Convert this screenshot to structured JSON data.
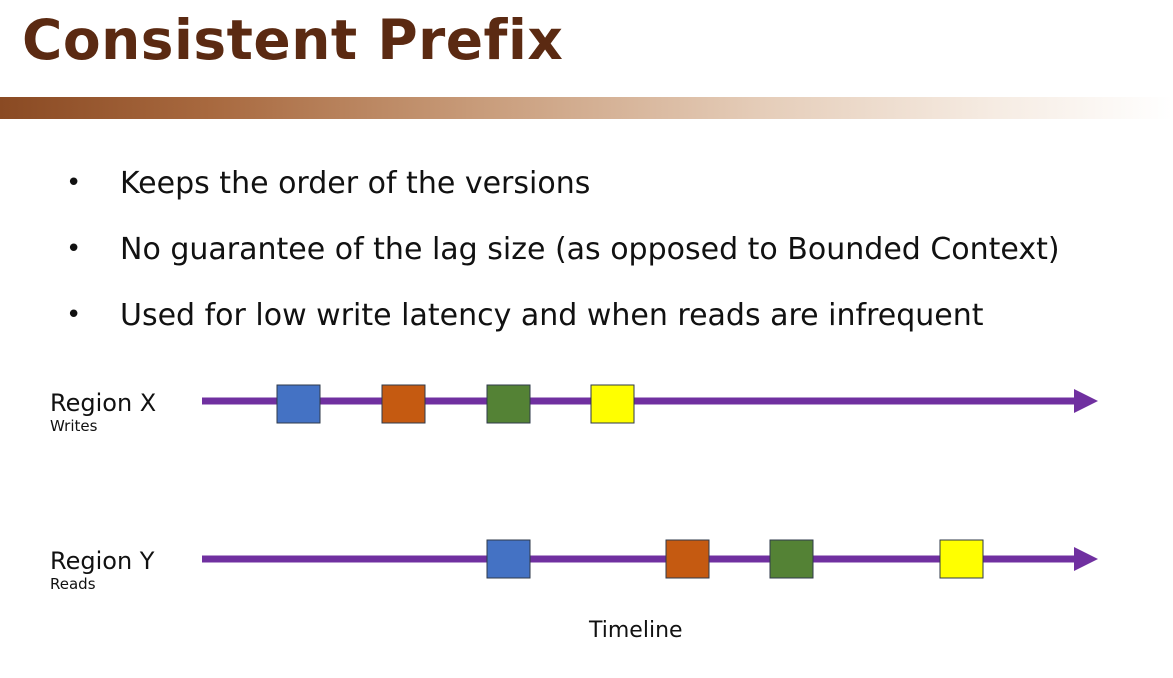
{
  "title": "Consistent Prefix",
  "bullets": [
    "Keeps the order of the versions",
    "No guarantee of the lag size (as opposed to Bounded Context)",
    "Used for low write latency and when reads are infrequent"
  ],
  "regions": [
    {
      "name": "Region X",
      "subtitle": "Writes",
      "versions": [
        "blue",
        "orange",
        "green",
        "yellow"
      ]
    },
    {
      "name": "Region Y",
      "subtitle": "Reads",
      "versions": [
        "blue",
        "orange",
        "green",
        "yellow"
      ]
    }
  ],
  "timeline_label": "Timeline",
  "colors": {
    "title": "#5b2a12",
    "timeline": "#7030a0",
    "blue": "#4472c4",
    "orange": "#c55a11",
    "green": "#548235",
    "yellow": "#ffff00"
  }
}
